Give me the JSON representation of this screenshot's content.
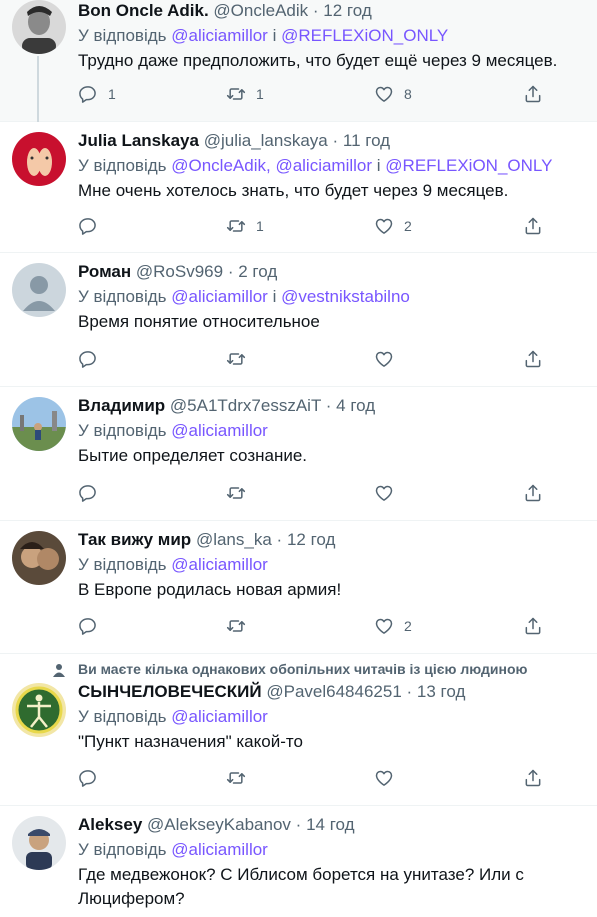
{
  "reply_prefix": "У відповідь",
  "conj": "і",
  "sep": "·",
  "tweets": [
    {
      "name": "Bon Oncle Adik.",
      "handle": "@OncleAdik",
      "time": "12 год",
      "mentions": [
        "@aliciamillor",
        "@REFLEXiON_ONLY"
      ],
      "text": "Трудно даже предположить, что будет ещё через 9 месяцев.",
      "replies": "1",
      "retweets": "1",
      "likes": "8"
    },
    {
      "name": "Julia Lanskaya",
      "handle": "@julia_lanskaya",
      "time": "11 год",
      "mentions": [
        "@OncleAdik,",
        "@aliciamillor",
        "@REFLEXiON_ONLY"
      ],
      "text": "Мне очень хотелось знать, что будет через 9 месяцев.",
      "replies": "",
      "retweets": "1",
      "likes": "2"
    },
    {
      "name": "Роман",
      "handle": "@RoSv969",
      "time": "2 год",
      "mentions": [
        "@aliciamillor",
        "@vestnikstabilno"
      ],
      "text": "Время понятие относительное",
      "replies": "",
      "retweets": "",
      "likes": ""
    },
    {
      "name": "Владимир",
      "handle": "@5A1Tdrx7esszAiT",
      "time": "4 год",
      "mentions": [
        "@aliciamillor"
      ],
      "text": "Бытие определяет сознание.",
      "replies": "",
      "retweets": "",
      "likes": ""
    },
    {
      "name": "Так вижу мир",
      "handle": "@lans_ka",
      "time": "12 год",
      "mentions": [
        "@aliciamillor"
      ],
      "text": "В Европе родилась новая армия!",
      "replies": "",
      "retweets": "",
      "likes": "2"
    },
    {
      "social": "Ви маєте кілька однакових обопільних читачів із цією людиною",
      "name": "СЫНЧЕЛОВЕЧЕСКИЙ",
      "handle": "@Pavel64846251",
      "time": "13 год",
      "mentions": [
        "@aliciamillor"
      ],
      "text": "\"Пункт назначения\" какой-то",
      "replies": "",
      "retweets": "",
      "likes": ""
    },
    {
      "name": "Aleksey",
      "handle": "@AlekseyKabanov",
      "time": "14 год",
      "mentions": [
        "@aliciamillor"
      ],
      "text": "Где медвежонок? С Иблисом борется на унитазе? Или с Люцифером?"
    }
  ],
  "colors": {
    "mention": "#7856ff",
    "muted": "#536471",
    "highlight_bg": "#f7f9f9"
  },
  "icons": {
    "reply": "reply-icon",
    "retweet": "retweet-icon",
    "like": "like-icon",
    "share": "share-icon",
    "person": "person-icon"
  }
}
